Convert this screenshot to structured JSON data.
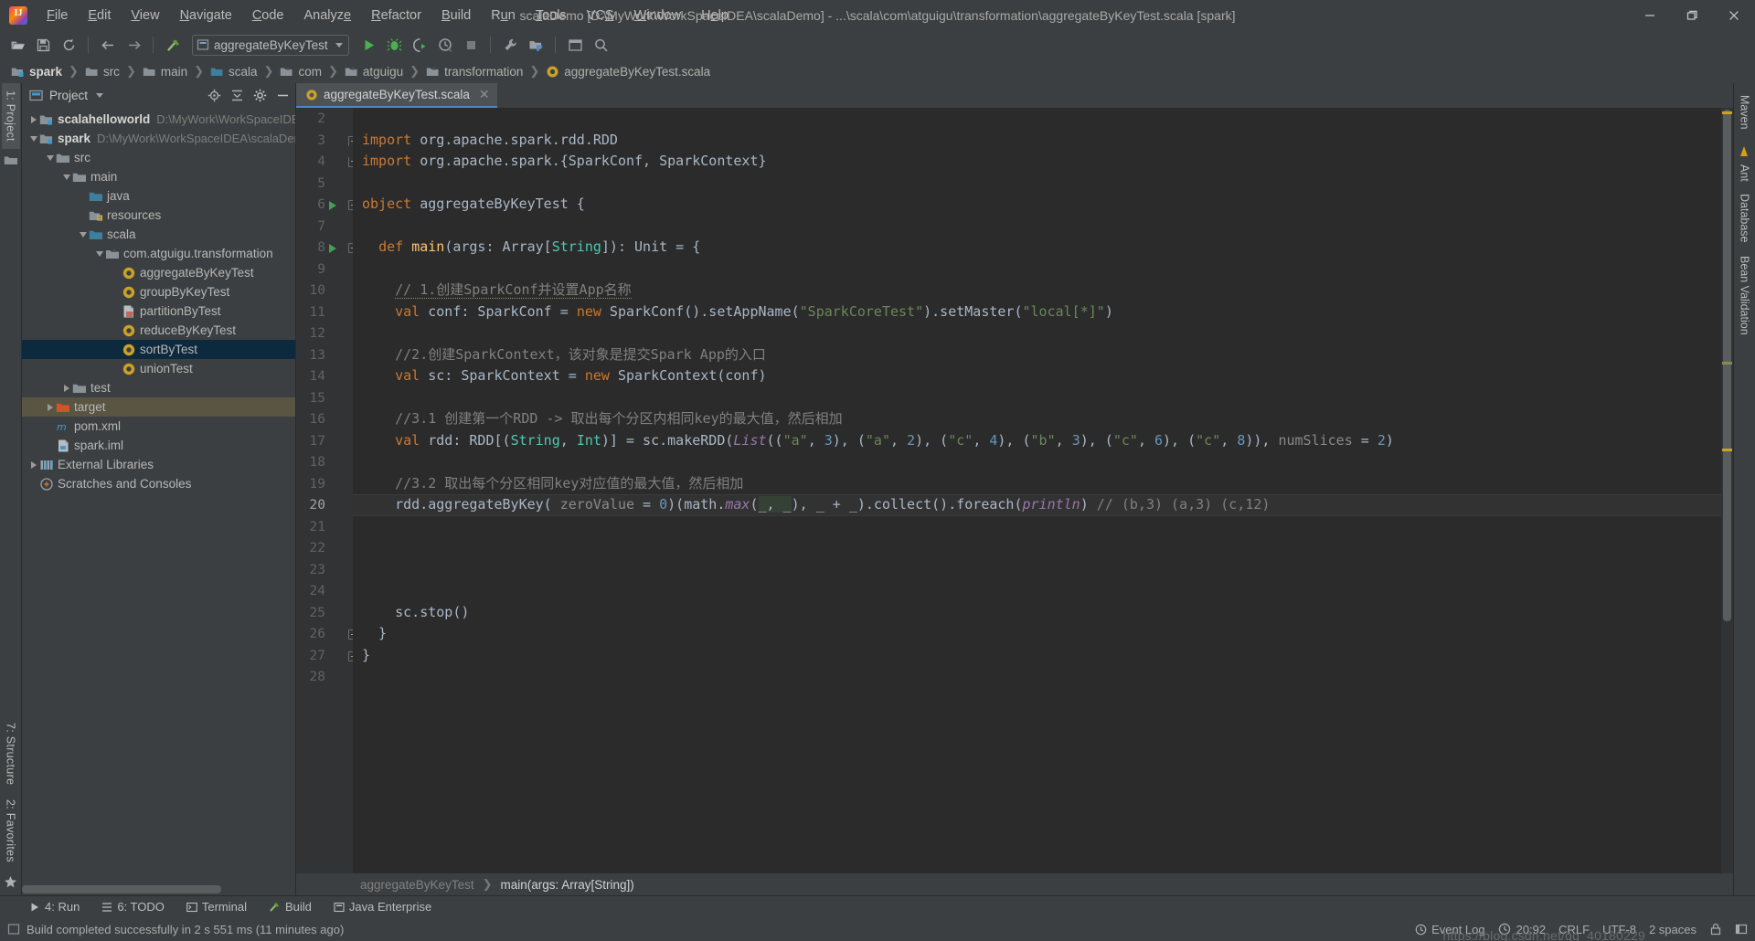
{
  "window": {
    "title": "scalaDemo [D:\\MyWork\\WorkSpaceIDEA\\scalaDemo] - ...\\scala\\com\\atguigu\\transformation\\aggregateByKeyTest.scala [spark]",
    "minimize": "—",
    "maximize": "❐",
    "close": "✕"
  },
  "menu": [
    "File",
    "Edit",
    "View",
    "Navigate",
    "Code",
    "Analyze",
    "Refactor",
    "Build",
    "Run",
    "Tools",
    "VCS",
    "Window",
    "Help"
  ],
  "toolbar": {
    "run_config": "aggregateByKeyTest",
    "icons": [
      "open-folder-icon",
      "save-icon",
      "sync-icon",
      "back-arrow-icon",
      "forward-arrow-icon",
      "build-hammer-icon",
      "run-icon",
      "debug-icon",
      "run-coverage-icon",
      "profile-icon",
      "stop-icon",
      "settings-wrench-icon",
      "project-structure-icon",
      "layout-icon",
      "search-icon"
    ]
  },
  "breadcrumb": [
    {
      "label": "spark",
      "icon": "module-icon",
      "bold": true
    },
    {
      "label": "src",
      "icon": "folder-icon",
      "bold": false
    },
    {
      "label": "main",
      "icon": "folder-icon",
      "bold": false
    },
    {
      "label": "scala",
      "icon": "source-folder-icon",
      "bold": false
    },
    {
      "label": "com",
      "icon": "package-icon",
      "bold": false
    },
    {
      "label": "atguigu",
      "icon": "package-icon",
      "bold": false
    },
    {
      "label": "transformation",
      "icon": "package-icon",
      "bold": false
    },
    {
      "label": "aggregateByKeyTest.scala",
      "icon": "scala-object-icon",
      "bold": false
    }
  ],
  "left_rail": {
    "project_tab": "1: Project",
    "structure_tab": "7: Structure",
    "favorites_tab": "2: Favorites"
  },
  "right_rail": {
    "maven_tab": "Maven",
    "ant_tab": "Ant",
    "database_tab": "Database",
    "bean_validation_tab": "Bean Validation"
  },
  "project_panel": {
    "title": "Project",
    "actions": [
      "locate-target-icon",
      "collapse-all-icon",
      "settings-gear-icon",
      "hide-panel-icon"
    ],
    "tree": [
      {
        "label": "scalahelloworld",
        "path": "D:\\MyWork\\WorkSpaceIDEA",
        "indent": 0,
        "twisty": "right",
        "icon": "module-icon",
        "bold": true,
        "selected": false
      },
      {
        "label": "spark",
        "path": "D:\\MyWork\\WorkSpaceIDEA\\scalaDem",
        "indent": 0,
        "twisty": "down",
        "icon": "module-icon",
        "bold": true,
        "selected": false
      },
      {
        "label": "src",
        "path": "",
        "indent": 1,
        "twisty": "down",
        "icon": "folder-icon",
        "bold": false,
        "selected": false
      },
      {
        "label": "main",
        "path": "",
        "indent": 2,
        "twisty": "down",
        "icon": "folder-icon",
        "bold": false,
        "selected": false
      },
      {
        "label": "java",
        "path": "",
        "indent": 3,
        "twisty": "none",
        "icon": "source-folder-icon",
        "bold": false,
        "selected": false
      },
      {
        "label": "resources",
        "path": "",
        "indent": 3,
        "twisty": "none",
        "icon": "resources-folder-icon",
        "bold": false,
        "selected": false
      },
      {
        "label": "scala",
        "path": "",
        "indent": 3,
        "twisty": "down",
        "icon": "source-folder-icon",
        "bold": false,
        "selected": false
      },
      {
        "label": "com.atguigu.transformation",
        "path": "",
        "indent": 4,
        "twisty": "down",
        "icon": "package-icon",
        "bold": false,
        "selected": false
      },
      {
        "label": "aggregateByKeyTest",
        "path": "",
        "indent": 5,
        "twisty": "none",
        "icon": "scala-object-icon",
        "bold": false,
        "selected": false
      },
      {
        "label": "groupByKeyTest",
        "path": "",
        "indent": 5,
        "twisty": "none",
        "icon": "scala-object-icon",
        "bold": false,
        "selected": false
      },
      {
        "label": "partitionByTest",
        "path": "",
        "indent": 5,
        "twisty": "none",
        "icon": "scala-file-icon",
        "bold": false,
        "selected": false
      },
      {
        "label": "reduceByKeyTest",
        "path": "",
        "indent": 5,
        "twisty": "none",
        "icon": "scala-object-icon",
        "bold": false,
        "selected": false
      },
      {
        "label": "sortByTest",
        "path": "",
        "indent": 5,
        "twisty": "none",
        "icon": "scala-object-icon",
        "bold": false,
        "selected": true
      },
      {
        "label": "unionTest",
        "path": "",
        "indent": 5,
        "twisty": "none",
        "icon": "scala-object-icon",
        "bold": false,
        "selected": false
      },
      {
        "label": "test",
        "path": "",
        "indent": 2,
        "twisty": "right",
        "icon": "folder-icon",
        "bold": false,
        "selected": false
      },
      {
        "label": "target",
        "path": "",
        "indent": 1,
        "twisty": "right",
        "icon": "target-folder-icon",
        "bold": false,
        "selected": false,
        "excluded": true
      },
      {
        "label": "pom.xml",
        "path": "",
        "indent": 1,
        "twisty": "none",
        "icon": "maven-xml-icon",
        "bold": false,
        "selected": false
      },
      {
        "label": "spark.iml",
        "path": "",
        "indent": 1,
        "twisty": "none",
        "icon": "iml-icon",
        "bold": false,
        "selected": false
      },
      {
        "label": "External Libraries",
        "path": "",
        "indent": 0,
        "twisty": "right",
        "icon": "libraries-icon",
        "bold": false,
        "selected": false
      },
      {
        "label": "Scratches and Consoles",
        "path": "",
        "indent": 0,
        "twisty": "none",
        "icon": "scratches-icon",
        "bold": false,
        "selected": false
      }
    ]
  },
  "editor": {
    "tab_label": "aggregateByKeyTest.scala",
    "tab_icon": "scala-object-icon",
    "tab_close": "✕",
    "first_line": 2,
    "lines": [
      {
        "n": 2,
        "text": ""
      },
      {
        "n": 3,
        "text": "import org.apache.spark.rdd.RDD"
      },
      {
        "n": 4,
        "text": "import org.apache.spark.{SparkConf, SparkContext}"
      },
      {
        "n": 5,
        "text": ""
      },
      {
        "n": 6,
        "text": "object aggregateByKeyTest {"
      },
      {
        "n": 7,
        "text": ""
      },
      {
        "n": 8,
        "text": "  def main(args: Array[String]): Unit = {"
      },
      {
        "n": 9,
        "text": ""
      },
      {
        "n": 10,
        "text": "    // 1.创建SparkConf并设置App名称"
      },
      {
        "n": 11,
        "text": "    val conf: SparkConf = new SparkConf().setAppName(\"SparkCoreTest\").setMaster(\"local[*]\")"
      },
      {
        "n": 12,
        "text": ""
      },
      {
        "n": 13,
        "text": "    //2.创建SparkContext，该对象是提交Spark App的入口"
      },
      {
        "n": 14,
        "text": "    val sc: SparkContext = new SparkContext(conf)"
      },
      {
        "n": 15,
        "text": ""
      },
      {
        "n": 16,
        "text": "    //3.1 创建第一个RDD -> 取出每个分区内相同key的最大值，然后相加"
      },
      {
        "n": 17,
        "text": "    val rdd: RDD[(String, Int)] = sc.makeRDD(List((\"a\", 3), (\"a\", 2), (\"c\", 4), (\"b\", 3), (\"c\", 6), (\"c\", 8)), numSlices = 2)"
      },
      {
        "n": 18,
        "text": ""
      },
      {
        "n": 19,
        "text": "    //3.2 取出每个分区相同key对应值的最大值，然后相加"
      },
      {
        "n": 20,
        "text": "    rdd.aggregateByKey( zeroValue = 0)(math.max(_, _), _ + _).collect().foreach(println) // (b,3) (a,3) (c,12)"
      },
      {
        "n": 21,
        "text": ""
      },
      {
        "n": 22,
        "text": ""
      },
      {
        "n": 23,
        "text": ""
      },
      {
        "n": 24,
        "text": ""
      },
      {
        "n": 25,
        "text": "    sc.stop()"
      },
      {
        "n": 26,
        "text": "  }"
      },
      {
        "n": 27,
        "text": "}"
      },
      {
        "n": 28,
        "text": ""
      }
    ],
    "current_line": 20,
    "breadcrumb": [
      "aggregateByKeyTest",
      "main(args: Array[String])"
    ]
  },
  "tool_windows": [
    {
      "label": "4: Run",
      "icon": "run-icon"
    },
    {
      "label": "6: TODO",
      "icon": "todo-icon"
    },
    {
      "label": "Terminal",
      "icon": "terminal-icon"
    },
    {
      "label": "Build",
      "icon": "build-icon"
    },
    {
      "label": "Java Enterprise",
      "icon": "java-enterprise-icon"
    }
  ],
  "status": {
    "message": "Build completed successfully in 2 s 551 ms (11 minutes ago)",
    "caret_position": "20:92",
    "line_separator": "CRLF",
    "encoding": "UTF-8",
    "indent": "2 spaces",
    "event_log": "Event Log",
    "watermark": "https://blog.csdn.net/qq_40180229"
  },
  "colors": {
    "accent": "#4a88c7",
    "keyword": "#cc7832",
    "string": "#6a8759",
    "number": "#6897bb",
    "comment": "#808080",
    "type": "#4ec9b0",
    "italic_ident": "#9876aa",
    "selection": "#0d293e",
    "excluded": "#5a5542",
    "run_green": "#499c54",
    "editor_bg": "#2b2b2b",
    "panel_bg": "#3c3f41"
  }
}
